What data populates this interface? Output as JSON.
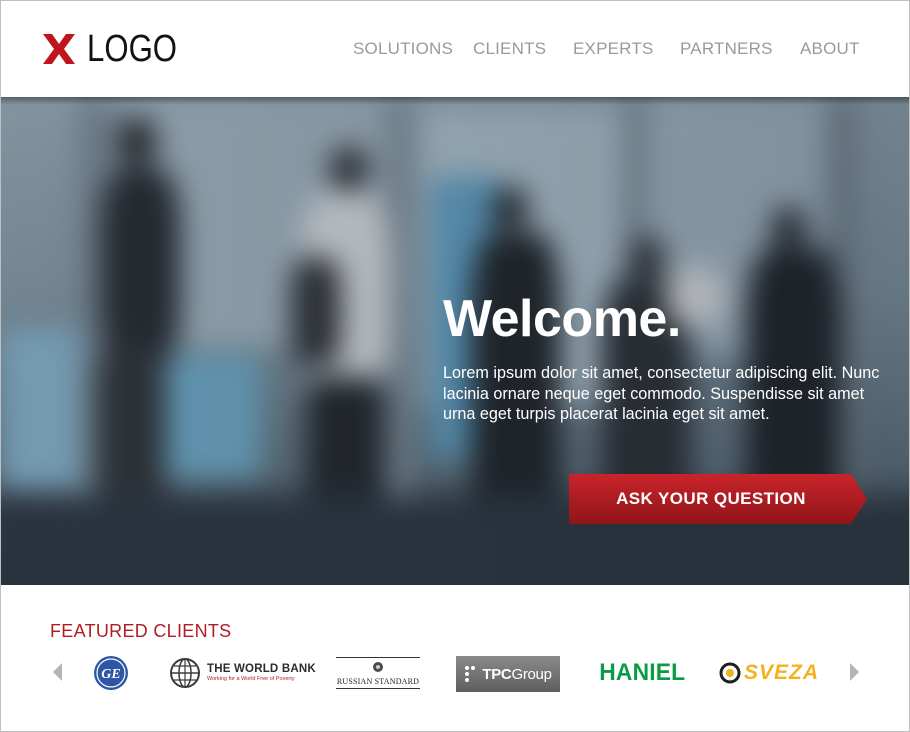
{
  "header": {
    "logo_text": "LOGO",
    "nav": [
      {
        "label": "SOLUTIONS"
      },
      {
        "label": "CLIENTS"
      },
      {
        "label": "EXPERTS"
      },
      {
        "label": "PARTNERS"
      },
      {
        "label": "ABOUT"
      }
    ]
  },
  "hero": {
    "title": "Welcome.",
    "body": "Lorem ipsum dolor sit amet, consectetur adipiscing elit. Nunc lacinia ornare neque eget commodo. Suspendisse sit amet urna eget turpis placerat lacinia eget sit amet.",
    "cta_label": "ASK YOUR QUESTION"
  },
  "featured": {
    "title": "FEATURED CLIENTS",
    "clients": {
      "ge": "GE",
      "world_bank_name": "THE WORLD BANK",
      "world_bank_tagline": "Working for a World Free of Poverty",
      "russian_standard": "RUSSIAN STANDARD",
      "tpc_main": "TPC",
      "tpc_sub": "Group",
      "haniel": "HANIEL",
      "sveza": "SVEZA"
    }
  },
  "colors": {
    "brand_red": "#b01e23",
    "nav_gray": "#9a9a9a",
    "haniel_green": "#0a9c45",
    "sveza_yellow": "#f2b31c"
  },
  "icons": {
    "logo_mark": "x-icon",
    "prev": "chevron-left-icon",
    "next": "chevron-right-icon",
    "world_bank": "globe-icon"
  }
}
